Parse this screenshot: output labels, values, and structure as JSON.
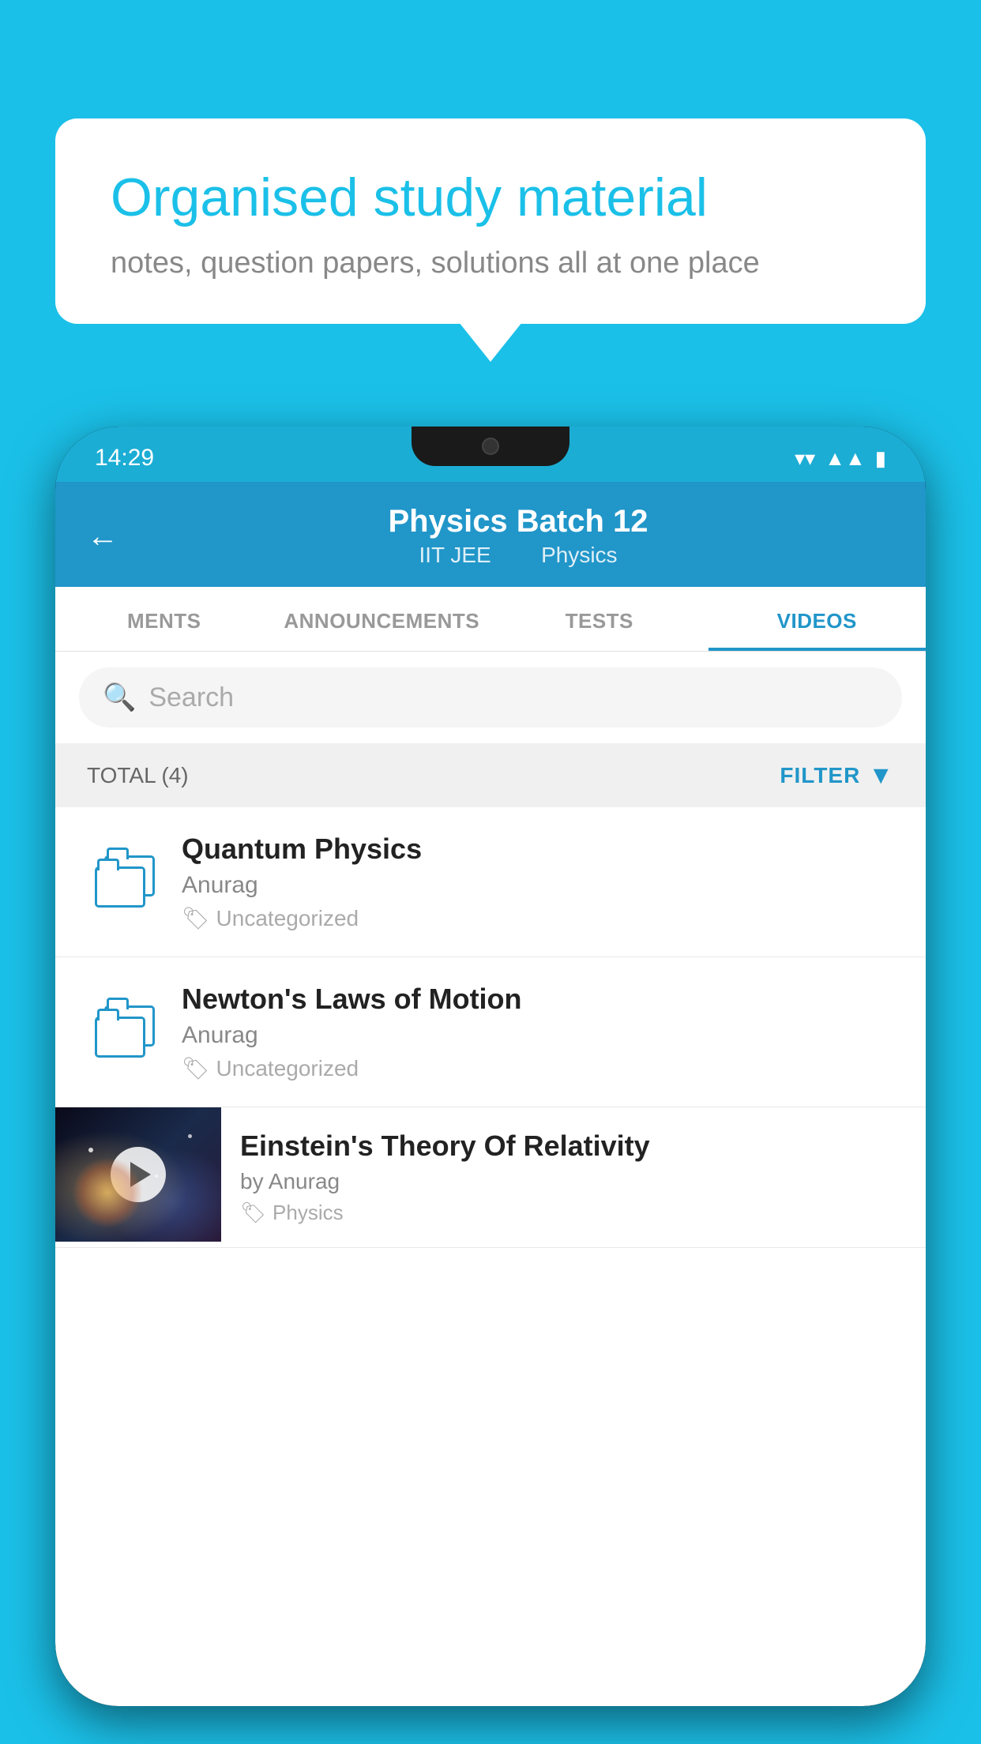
{
  "background": {
    "color": "#1BC0E8"
  },
  "speech_bubble": {
    "title": "Organised study material",
    "subtitle": "notes, question papers, solutions all at one place"
  },
  "phone": {
    "status_bar": {
      "time": "14:29"
    },
    "header": {
      "title": "Physics Batch 12",
      "subtitle1": "IIT JEE",
      "subtitle2": "Physics",
      "back_label": "←"
    },
    "tabs": [
      {
        "label": "MENTS",
        "active": false
      },
      {
        "label": "ANNOUNCEMENTS",
        "active": false
      },
      {
        "label": "TESTS",
        "active": false
      },
      {
        "label": "VIDEOS",
        "active": true
      }
    ],
    "search": {
      "placeholder": "Search"
    },
    "filter_bar": {
      "total": "TOTAL (4)",
      "filter_label": "FILTER"
    },
    "videos": [
      {
        "title": "Quantum Physics",
        "author": "Anurag",
        "tag": "Uncategorized",
        "type": "folder"
      },
      {
        "title": "Newton's Laws of Motion",
        "author": "Anurag",
        "tag": "Uncategorized",
        "type": "folder"
      },
      {
        "title": "Einstein's Theory Of Relativity",
        "author": "by Anurag",
        "tag": "Physics",
        "type": "video"
      }
    ]
  }
}
